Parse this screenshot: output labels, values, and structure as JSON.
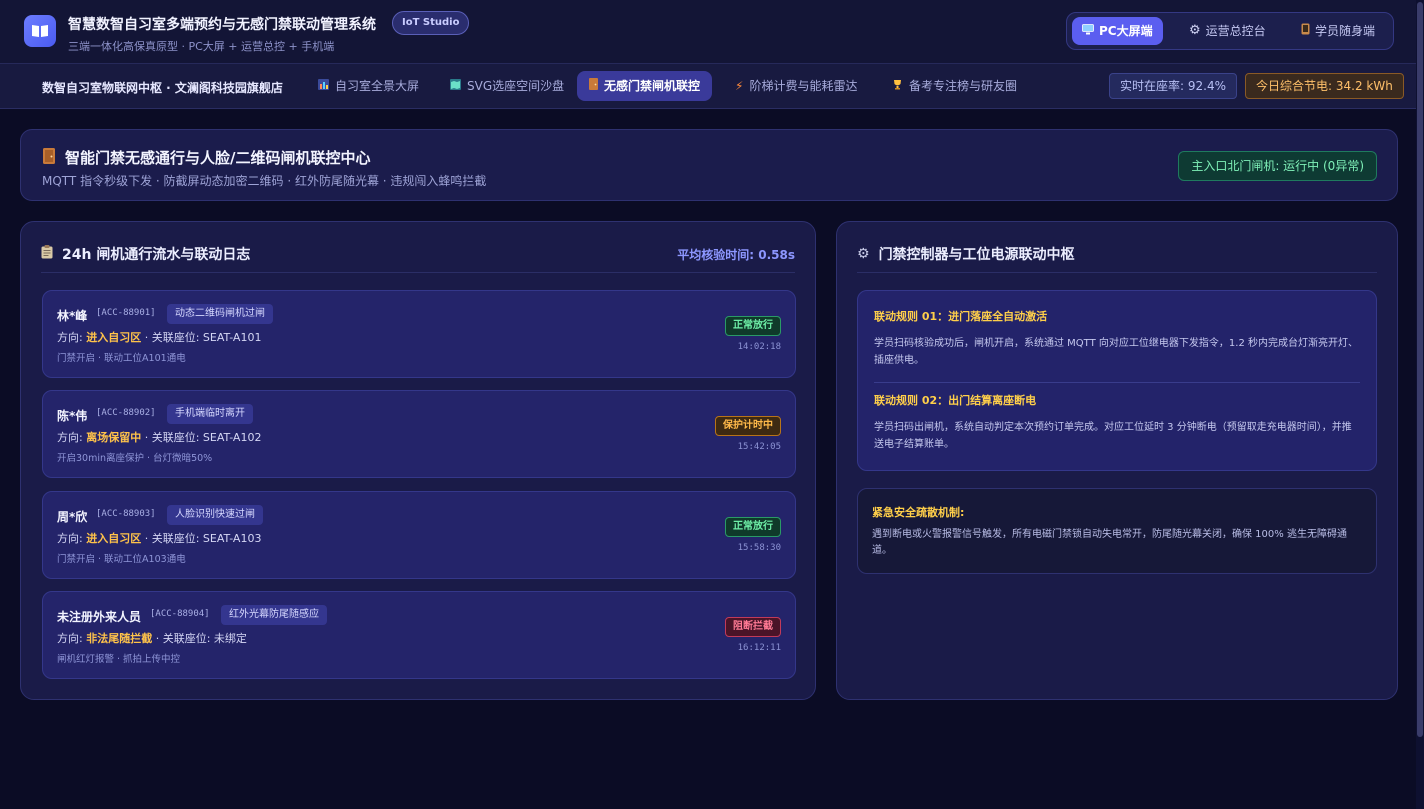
{
  "app": {
    "title": "智慧数智自习室多端预约与无感门禁联动管理系统",
    "badge": "IoT Studio",
    "subtitle": "三端一体化高保真原型 · PC大屏 + 运营总控 + 手机端"
  },
  "roles": [
    {
      "label": "PC大屏端",
      "icon": "monitor-icon",
      "active": true
    },
    {
      "label": "运营总控台",
      "icon": "gear-icon",
      "active": false
    },
    {
      "label": "学员随身端",
      "icon": "phone-icon",
      "active": false
    }
  ],
  "nav": {
    "brand": "数智自习室物联网中枢 · 文澜阁科技园旗舰店",
    "tabs": [
      {
        "label": "自习室全景大屏",
        "icon": "chart-icon"
      },
      {
        "label": "SVG选座空间沙盘",
        "icon": "map-icon"
      },
      {
        "label": "无感门禁闸机联控",
        "icon": "door-icon",
        "active": true
      },
      {
        "label": "阶梯计费与能耗雷达",
        "icon": "lightning-icon"
      },
      {
        "label": "备考专注榜与研友圈",
        "icon": "trophy-icon"
      }
    ],
    "occupancy": "实时在座率: 92.4%",
    "energy": "今日综合节电: 34.2 kWh"
  },
  "hero": {
    "title": "智能门禁无感通行与人脸/二维码闸机联控中心",
    "subtitle": "MQTT 指令秒级下发 · 防截屏动态加密二维码 · 红外防尾随光幕 · 违规闯入蜂鸣拦截",
    "status": "主入口北门闸机: 运行中 (0异常)"
  },
  "log_panel": {
    "title": "24h 闸机通行流水与联动日志",
    "meta": "平均核验时间: 0.58s",
    "entries": [
      {
        "name": "林*峰",
        "id": "[ACC-88901]",
        "method": "动态二维码闸机过闸",
        "dir_prefix": "方向: ",
        "direction": "进入自习区",
        "seat": " · 关联座位: SEAT-A101",
        "note": "门禁开启 · 联动工位A101通电",
        "status": "正常放行",
        "status_type": "ok",
        "time": "14:02:18"
      },
      {
        "name": "陈*伟",
        "id": "[ACC-88902]",
        "method": "手机端临时离开",
        "dir_prefix": "方向: ",
        "direction": "离场保留中",
        "seat": " · 关联座位: SEAT-A102",
        "note": "开启30min离座保护 · 台灯微暗50%",
        "status": "保护计时中",
        "status_type": "warn",
        "time": "15:42:05"
      },
      {
        "name": "周*欣",
        "id": "[ACC-88903]",
        "method": "人脸识别快速过闸",
        "dir_prefix": "方向: ",
        "direction": "进入自习区",
        "seat": " · 关联座位: SEAT-A103",
        "note": "门禁开启 · 联动工位A103通电",
        "status": "正常放行",
        "status_type": "ok",
        "time": "15:58:30"
      },
      {
        "name": "未注册外来人员",
        "id": "[ACC-88904]",
        "method": "红外光幕防尾随感应",
        "dir_prefix": "方向: ",
        "direction": "非法尾随拦截",
        "seat": " · 关联座位: 未绑定",
        "note": "闸机红灯报警 · 抓拍上传中控",
        "status": "阻断拦截",
        "status_type": "block",
        "time": "16:12:11"
      }
    ]
  },
  "control_panel": {
    "title": "门禁控制器与工位电源联动中枢",
    "rules": [
      {
        "title": "联动规则 01：进门落座全自动激活",
        "desc": "学员扫码核验成功后，闸机开启，系统通过 MQTT 向对应工位继电器下发指令，1.2 秒内完成台灯渐亮开灯、插座供电。"
      },
      {
        "title": "联动规则 02：出门结算离座断电",
        "desc": "学员扫码出闸机，系统自动判定本次预约订单完成。对应工位延时 3 分钟断电（预留取走充电器时间），并推送电子结算账单。"
      }
    ],
    "safety": {
      "title": "紧急安全疏散机制:",
      "desc": "遇到断电或火警报警信号触发，所有电磁门禁锁自动失电常开，防尾随光幕关闭，确保 100% 逃生无障碍通道。"
    }
  }
}
